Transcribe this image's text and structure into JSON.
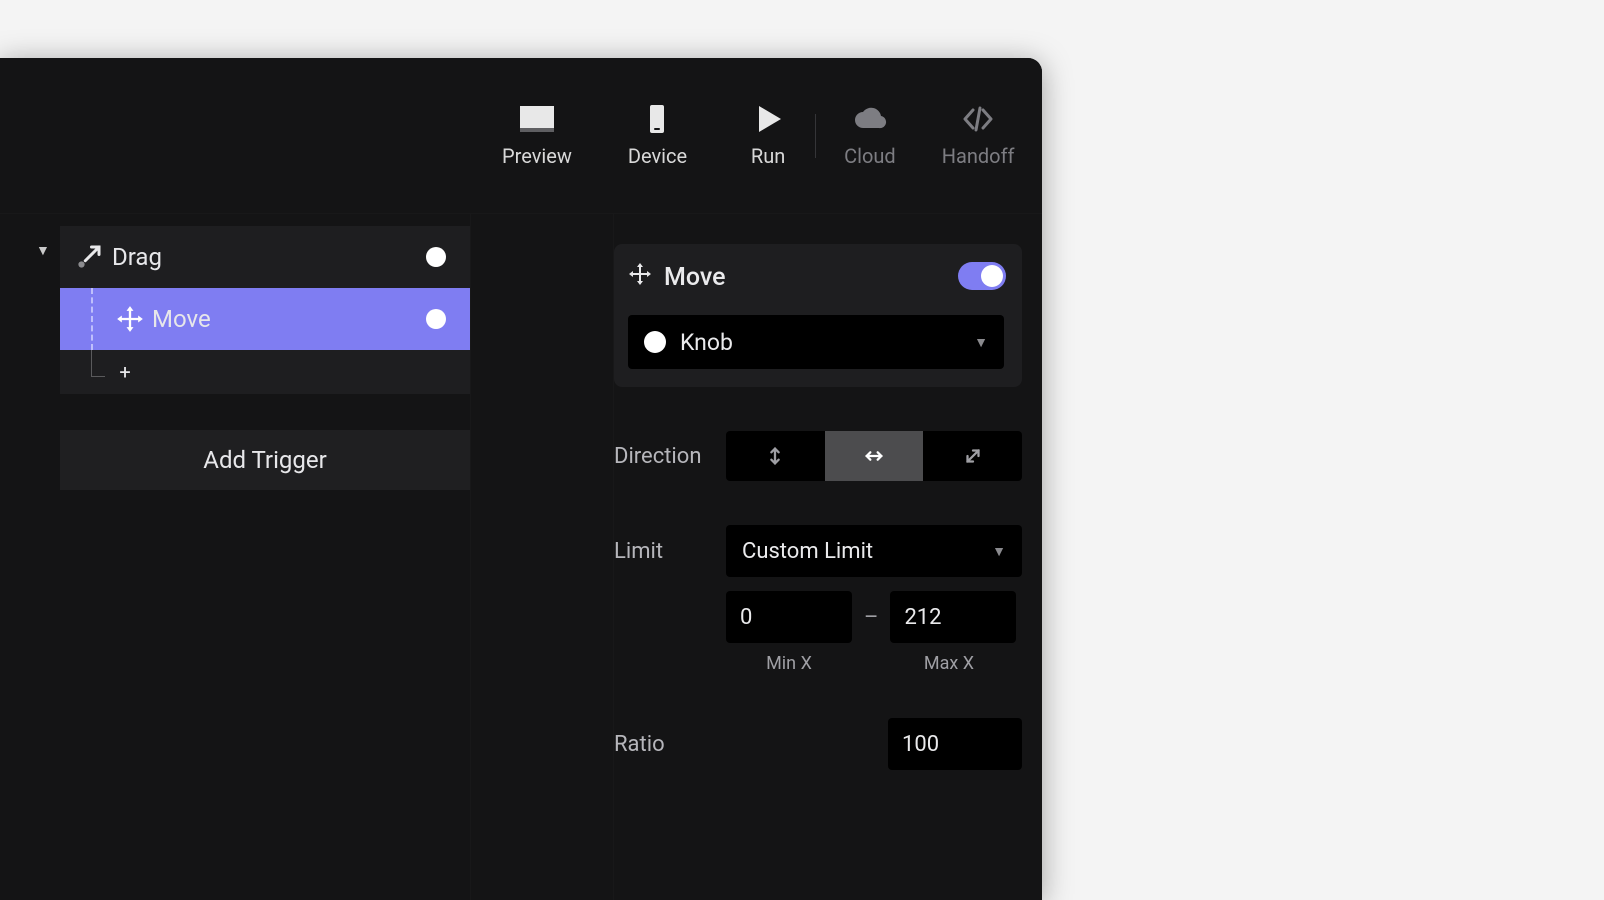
{
  "toolbar": {
    "preview": "Preview",
    "device": "Device",
    "run": "Run",
    "cloud": "Cloud",
    "handoff": "Handoff"
  },
  "outline": {
    "drag_label": "Drag",
    "move_label": "Move",
    "add_trigger_label": "Add Trigger"
  },
  "inspector": {
    "header_label": "Move",
    "target_label": "Knob",
    "direction_label": "Direction",
    "limit_label": "Limit",
    "limit_select": "Custom Limit",
    "min_value": "0",
    "max_value": "212",
    "min_caption": "Min X",
    "max_caption": "Max X",
    "ratio_label": "Ratio",
    "ratio_value": "100"
  }
}
